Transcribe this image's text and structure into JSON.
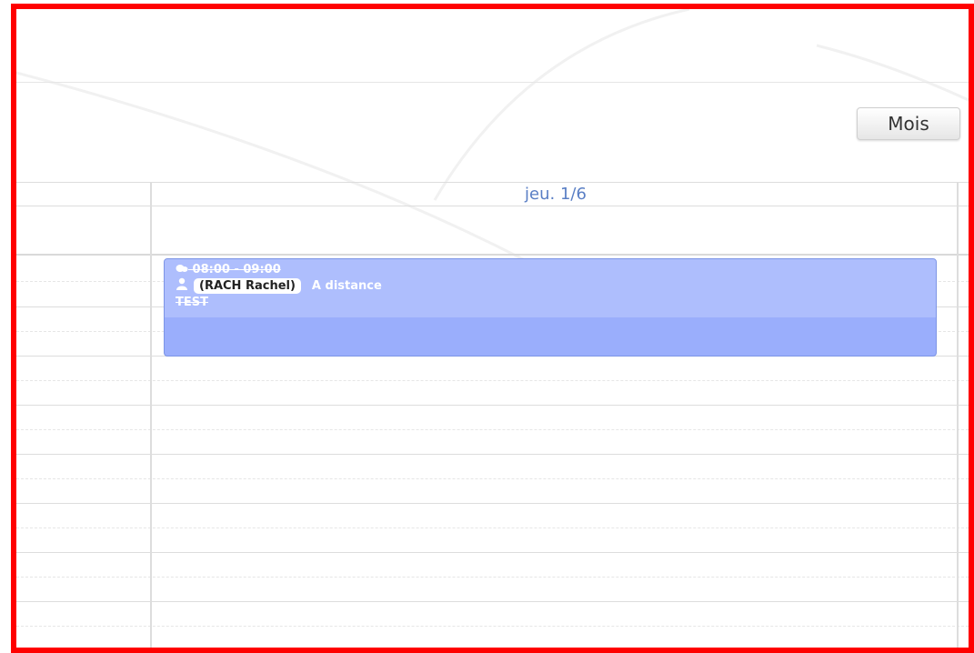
{
  "toolbar": {
    "view_button_label": "Mois"
  },
  "calendar": {
    "day_header": "jeu. 1/6",
    "event": {
      "time": "08:00 - 09:00",
      "trainer": "(RACH Rachel)",
      "location": "A distance",
      "title": "TEST",
      "time_icon": "clock-icon",
      "person_icon": "user-icon"
    }
  },
  "colors": {
    "frame_border": "#ff0000",
    "event_bg": "#9aaefc",
    "event_top_bg": "#aebefd",
    "day_header_text": "#5a7fc5"
  }
}
